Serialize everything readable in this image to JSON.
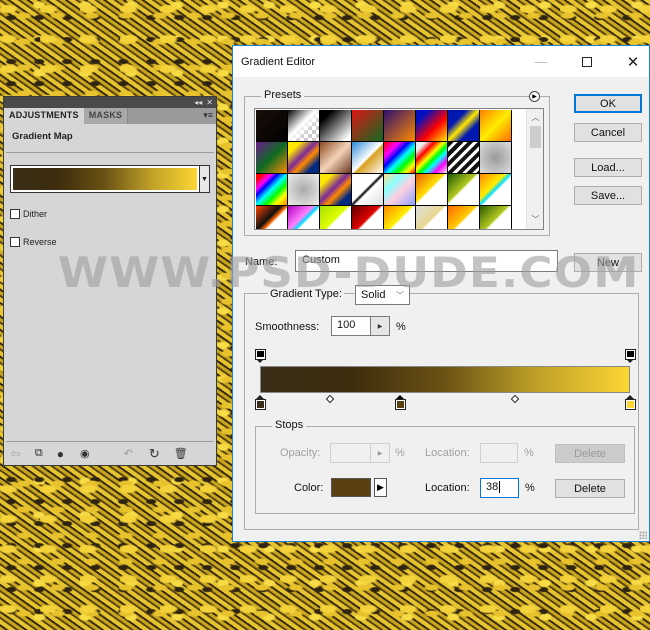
{
  "adjustments_panel": {
    "tabs": [
      {
        "label": "ADJUSTMENTS",
        "active": true
      },
      {
        "label": "MASKS",
        "active": false
      }
    ],
    "collapse_icon": "double-chevron-left-icon",
    "close_icon": "close-icon",
    "menu_icon": "panel-menu-icon",
    "title": "Gradient Map",
    "gradient_dropdown_icon": "dropdown-arrow-icon",
    "dither_label": "Dither",
    "dither_checked": false,
    "reverse_label": "Reverse",
    "reverse_checked": false,
    "bottom_icons": [
      "back-arrow-icon",
      "clip-to-layer-icon",
      "visibility-eye-icon",
      "view-previous-state-icon",
      "view-previous-icon",
      "reset-icon",
      "trash-icon"
    ]
  },
  "dialog": {
    "title": "Gradient Editor",
    "window_controls": {
      "minimize": "—",
      "close": "✕"
    },
    "presets": {
      "label": "Presets",
      "menu_icon": "flyout-menu-icon",
      "swatches": [
        "linear-gradient(135deg,#1a0f0a,#000)",
        "linear-gradient(135deg,#000 0%,#fff 45%,rgba(255,255,255,0) 70%)",
        "linear-gradient(135deg,#000 0%,#000 20%,#fff 90%)",
        "linear-gradient(135deg,#e01515,#0f6b22)",
        "linear-gradient(135deg,#2a0e70,#ff8a00)",
        "linear-gradient(135deg,#0010c0 20%,#ff0000 60%,#ffee00)",
        "linear-gradient(135deg,#0018b0 30%,#ffe800 50%,#0018b0 70%)",
        "linear-gradient(135deg,#ff7e00,#ffee00 50%,#ff6a00)",
        "linear-gradient(135deg,#6b1a8a,#0d6b22 50%,#ff8a00)",
        "linear-gradient(135deg,#ffe600 20%,#7a2a9a 45%,#ff8a00 60%,#002a80 80%)",
        "linear-gradient(135deg,#8a4a20,#f4d2b8 50%,#6a3420)",
        "linear-gradient(135deg,#2a8ad8,#fff 50%,#d8a020 55%,#fff)",
        "linear-gradient(135deg,#ff0000,#ff00ff 25%,#0000ff 40%,#00ffff 55%,#00ff00 70%,#ffff00 85%,#ff0000)",
        "linear-gradient(135deg,#eee 15%,#ff0000 30%,#ffff00 45%,#00ff00 55%,#00ffff 65%,#ff00ff 80%,#eee)",
        "repeating-linear-gradient(135deg,#111 0 4px,#fff 4px 7px)",
        "radial-gradient(circle,#999,#ddd)",
        "linear-gradient(135deg,#ff0000 10%,#ff00ff 25%,#0000ff 35%,#00ffff 50%,#00ff00 65%,#ffff00 80%,#ff8800)",
        "radial-gradient(circle,#aaa,#eee)",
        "linear-gradient(135deg,#ffe600 20%,#7a2a9a 45%,#ff8a00 60%,#002a80 80%)",
        "linear-gradient(135deg,#fff 45%,#000 50%,#fff 55%,#ddd)",
        "linear-gradient(135deg,#ffe08a,#8affff 30%,#ffd0e0 55%,#8aa0ff)",
        "linear-gradient(135deg,#e85a00,#ffe000 45%,#fff 50%)",
        "linear-gradient(135deg,#1e5a00,#b0c820 45%,#fff 50%)",
        "linear-gradient(135deg,#ff8800,#ffee00 40%,#00e0ff 50%,#fff 55%)",
        "linear-gradient(135deg,#ff4400,#111 40%,#ff6600 50%,#fff 55%)",
        "linear-gradient(135deg,#b000c0,#ff80ff 40%,#00e0ff 50%,#fff 55%)",
        "linear-gradient(135deg,#a8e000,#e0ff00 45%,#fff 50%)",
        "linear-gradient(135deg,#600000,#e00000 45%,#fff 50%)",
        "linear-gradient(135deg,#ff8800,#ffee00 45%,#fff 50%)",
        "linear-gradient(135deg,#ddd,#e8d890 45%,#fff 50%)",
        "linear-gradient(135deg,#ff6600,#ffcc00 45%,#fff 50%)",
        "linear-gradient(135deg,#2a5a00,#b0c820 45%,#fff 50%)"
      ],
      "scroll_up_icon": "chevron-up-icon",
      "scroll_down_icon": "chevron-down-icon"
    },
    "buttons": {
      "ok": "OK",
      "cancel": "Cancel",
      "load": "Load...",
      "save": "Save...",
      "new": "New"
    },
    "name_label": "Name:",
    "name_value": "Custom",
    "gradient_type_label": "Gradient Type:",
    "gradient_type_value": "Solid",
    "smoothness_label": "Smoothness:",
    "smoothness_value": "100",
    "smoothness_unit": "%",
    "gradient": {
      "color_stops": [
        {
          "location": 0,
          "color": "#3a2e18"
        },
        {
          "location": 38,
          "color": "#5a3f12",
          "selected": true
        },
        {
          "location": 100,
          "color": "#fcd633"
        }
      ],
      "opacity_stops": [
        {
          "location": 0,
          "opacity": 100
        },
        {
          "location": 100,
          "opacity": 100
        }
      ],
      "midpoints": [
        19,
        69
      ]
    },
    "stops": {
      "label": "Stops",
      "opacity_label": "Opacity:",
      "opacity_value": "",
      "opacity_unit": "%",
      "opacity_location_label": "Location:",
      "opacity_location_value": "",
      "opacity_location_unit": "%",
      "opacity_delete": "Delete",
      "color_label": "Color:",
      "color_value": "#5a3f12",
      "color_location_label": "Location:",
      "color_location_value": "38",
      "color_location_unit": "%",
      "color_delete": "Delete"
    }
  },
  "watermark": "WWW.PSD-DUDE.COM"
}
